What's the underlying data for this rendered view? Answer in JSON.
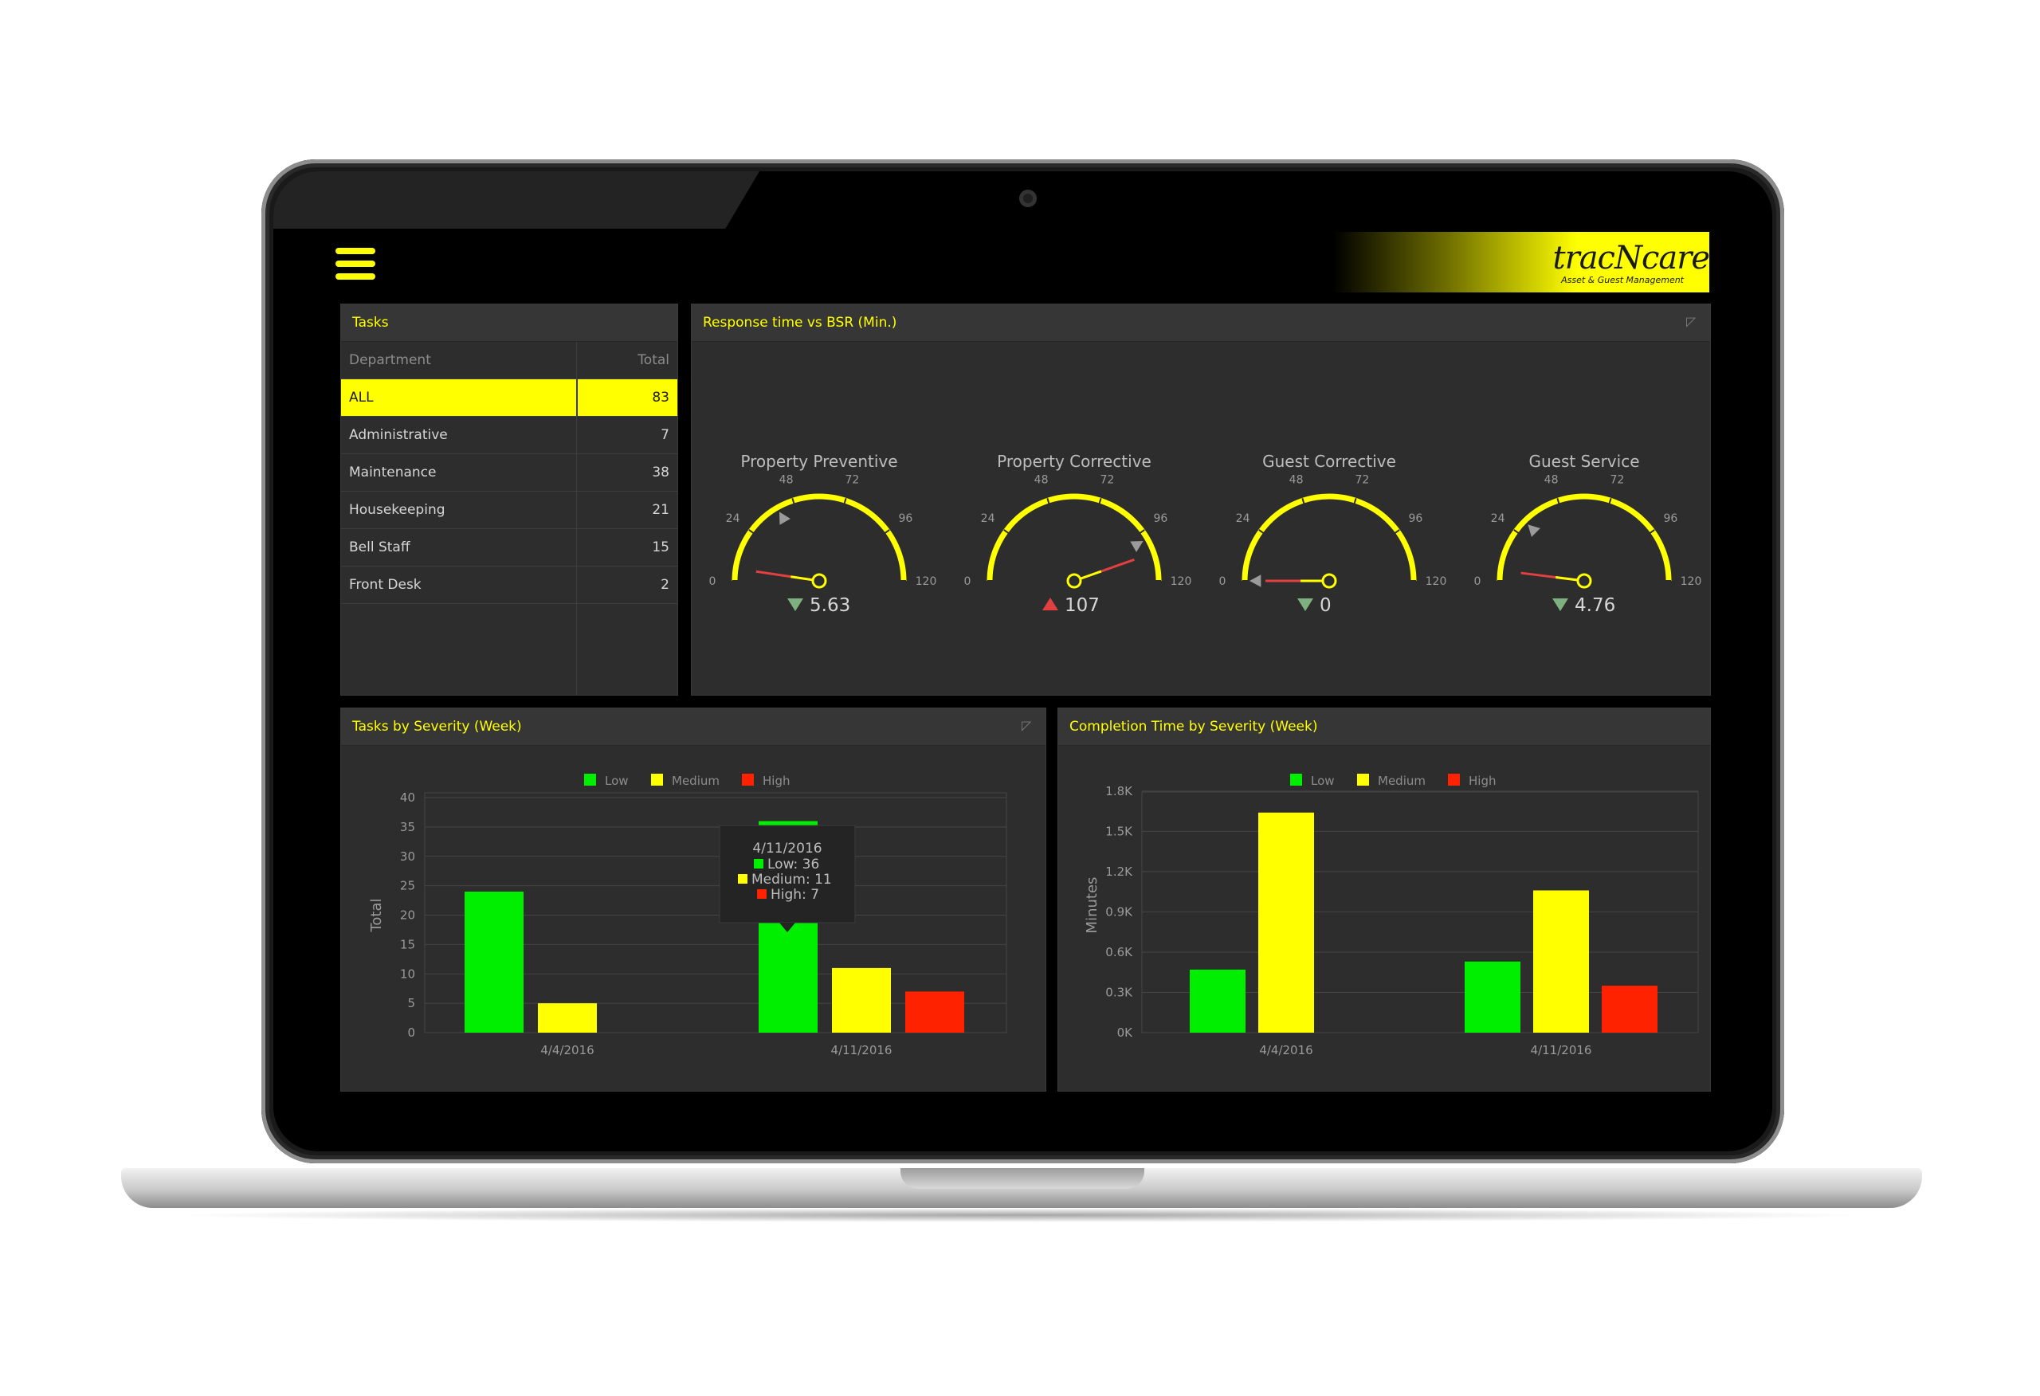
{
  "brand": {
    "name": "tracNcare",
    "subtitle": "Asset & Guest Management"
  },
  "tasks": {
    "title": "Tasks",
    "columns": [
      "Department",
      "Total"
    ],
    "rows": [
      {
        "department": "ALL",
        "total": "83",
        "selected": true
      },
      {
        "department": "Administrative",
        "total": "7"
      },
      {
        "department": "Maintenance",
        "total": "38"
      },
      {
        "department": "Housekeeping",
        "total": "21"
      },
      {
        "department": "Bell Staff",
        "total": "15"
      },
      {
        "department": "Front Desk",
        "total": "2"
      }
    ]
  },
  "response": {
    "title": "Response time vs BSR (Min.)",
    "gauges": [
      {
        "title": "Property Preventive",
        "value": 5.63,
        "value_label": "5.63",
        "target": 40,
        "trend": "down"
      },
      {
        "title": "Property Corrective",
        "value": 107,
        "value_label": "107",
        "target": 100,
        "trend": "up"
      },
      {
        "title": "Guest Corrective",
        "value": 0,
        "value_label": "0",
        "target": 0,
        "trend": "down"
      },
      {
        "title": "Guest Service",
        "value": 4.76,
        "value_label": "4.76",
        "target": 30,
        "trend": "down"
      }
    ],
    "scale_min": 0,
    "scale_max": 120,
    "ticks": [
      "0",
      "24",
      "48",
      "72",
      "96",
      "120"
    ]
  },
  "chart_data": [
    {
      "type": "bar",
      "title": "Tasks by Severity (Week)",
      "ylabel": "Total",
      "xlabel": "",
      "ylim": [
        0,
        40
      ],
      "yticks": [
        "0",
        "5",
        "10",
        "15",
        "20",
        "25",
        "30",
        "35",
        "40"
      ],
      "categories": [
        "4/4/2016",
        "4/11/2016"
      ],
      "series": [
        {
          "name": "Low",
          "color": "#00ee00",
          "values": [
            24,
            36
          ]
        },
        {
          "name": "Medium",
          "color": "#ffff00",
          "values": [
            5,
            11
          ]
        },
        {
          "name": "High",
          "color": "#ff2200",
          "values": [
            0,
            7
          ]
        }
      ],
      "tooltip": {
        "date": "4/11/2016",
        "lines": [
          "Low: 36",
          "Medium: 11",
          "High: 7"
        ]
      },
      "legend": "top-center",
      "grid": true
    },
    {
      "type": "bar",
      "title": "Completion Time by Severity (Week)",
      "ylabel": "Minutes",
      "xlabel": "",
      "ylim": [
        0,
        1900
      ],
      "yticks": [
        "0K",
        "0.3K",
        "0.6K",
        "0.9K",
        "1.2K",
        "1.5K",
        "1.8K"
      ],
      "categories": [
        "4/4/2016",
        "4/11/2016"
      ],
      "series": [
        {
          "name": "Low",
          "color": "#00ee00",
          "values": [
            470,
            530
          ]
        },
        {
          "name": "Medium",
          "color": "#ffff00",
          "values": [
            1640,
            1060
          ]
        },
        {
          "name": "High",
          "color": "#ff2200",
          "values": [
            0,
            350
          ]
        }
      ],
      "legend": "top-center",
      "grid": true
    }
  ],
  "colors": {
    "accent": "#ffff00",
    "panel_bg": "#2d2d2d",
    "screen_bg": "#000000",
    "trend_down": "#7fb07f",
    "trend_up": "#e04040",
    "needle": "#e04040"
  },
  "icons": {
    "menu": "hamburger-icon",
    "pin": "pin-icon"
  }
}
